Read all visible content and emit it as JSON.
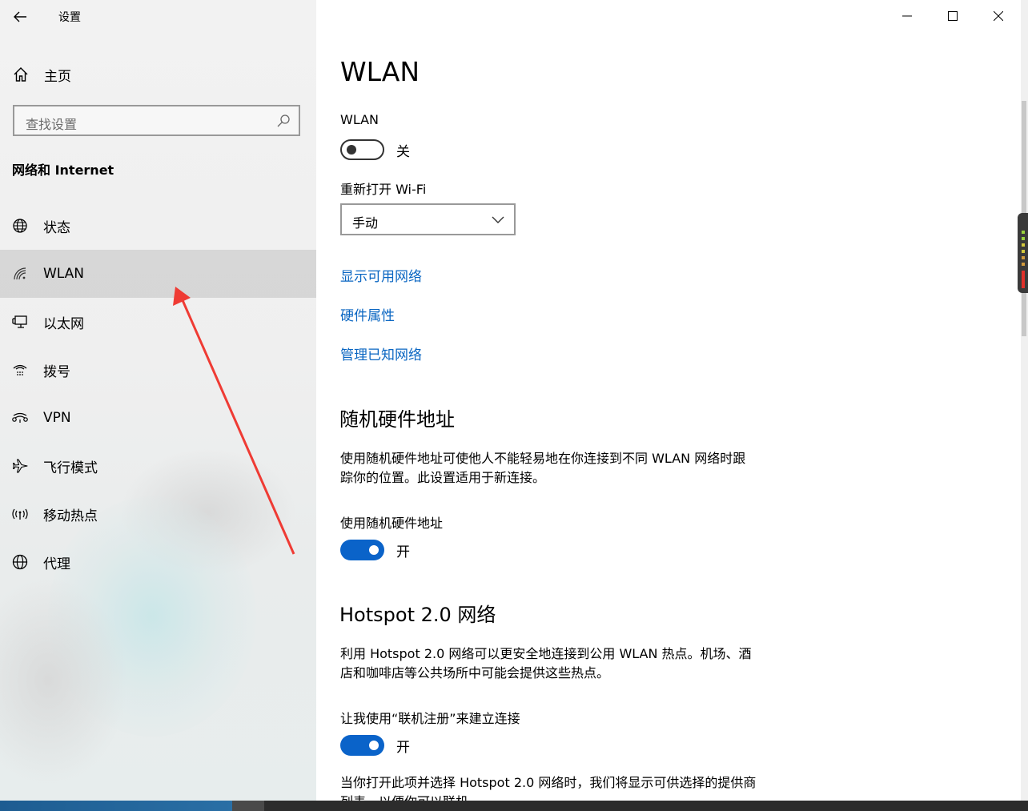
{
  "window": {
    "title": "设置",
    "controls": {
      "minimize": "minimize-icon",
      "maximize": "maximize-icon",
      "close": "close-icon"
    }
  },
  "sidebar": {
    "home_label": "主页",
    "search_placeholder": "查找设置",
    "section_title": "网络和 Internet",
    "items": [
      {
        "label": "状态",
        "icon": "globe-status-icon",
        "selected": false
      },
      {
        "label": "WLAN",
        "icon": "wifi-icon",
        "selected": true
      },
      {
        "label": "以太网",
        "icon": "ethernet-icon",
        "selected": false
      },
      {
        "label": "拨号",
        "icon": "dialup-icon",
        "selected": false
      },
      {
        "label": "VPN",
        "icon": "vpn-icon",
        "selected": false
      },
      {
        "label": "飞行模式",
        "icon": "airplane-icon",
        "selected": false
      },
      {
        "label": "移动热点",
        "icon": "hotspot-icon",
        "selected": false
      },
      {
        "label": "代理",
        "icon": "globe-icon",
        "selected": false
      }
    ]
  },
  "main": {
    "title": "WLAN",
    "wlan_label": "WLAN",
    "wlan_toggle": {
      "on": false,
      "state_text": "关"
    },
    "reopen_label": "重新打开 Wi-Fi",
    "reopen_dropdown": {
      "value": "手动"
    },
    "links": [
      "显示可用网络",
      "硬件属性",
      "管理已知网络"
    ],
    "random_hw": {
      "heading": "随机硬件地址",
      "description_line1": "使用随机硬件地址可使他人不能轻易地在你连接到不同 WLAN 网络时跟",
      "description_line2": "踪你的位置。此设置适用于新连接。",
      "toggle_label": "使用随机硬件地址",
      "toggle": {
        "on": true,
        "state_text": "开"
      }
    },
    "hotspot": {
      "heading": "Hotspot 2.0 网络",
      "description_line1": "利用 Hotspot 2.0 网络可以更安全地连接到公用 WLAN 热点。机场、酒",
      "description_line2": "店和咖啡店等公共场所中可能会提供这些热点。",
      "toggle_label": "让我使用“联机注册”来建立连接",
      "toggle": {
        "on": true,
        "state_text": "开"
      },
      "footer_line1": "当你打开此项并选择 Hotspot 2.0 网络时，我们将显示可供选择的提供商",
      "footer_line2": "列表，以便你可以联机"
    }
  },
  "colors": {
    "accent": "#0a63c9",
    "link": "#0a66c2",
    "annotation_arrow": "#ef3b34"
  }
}
